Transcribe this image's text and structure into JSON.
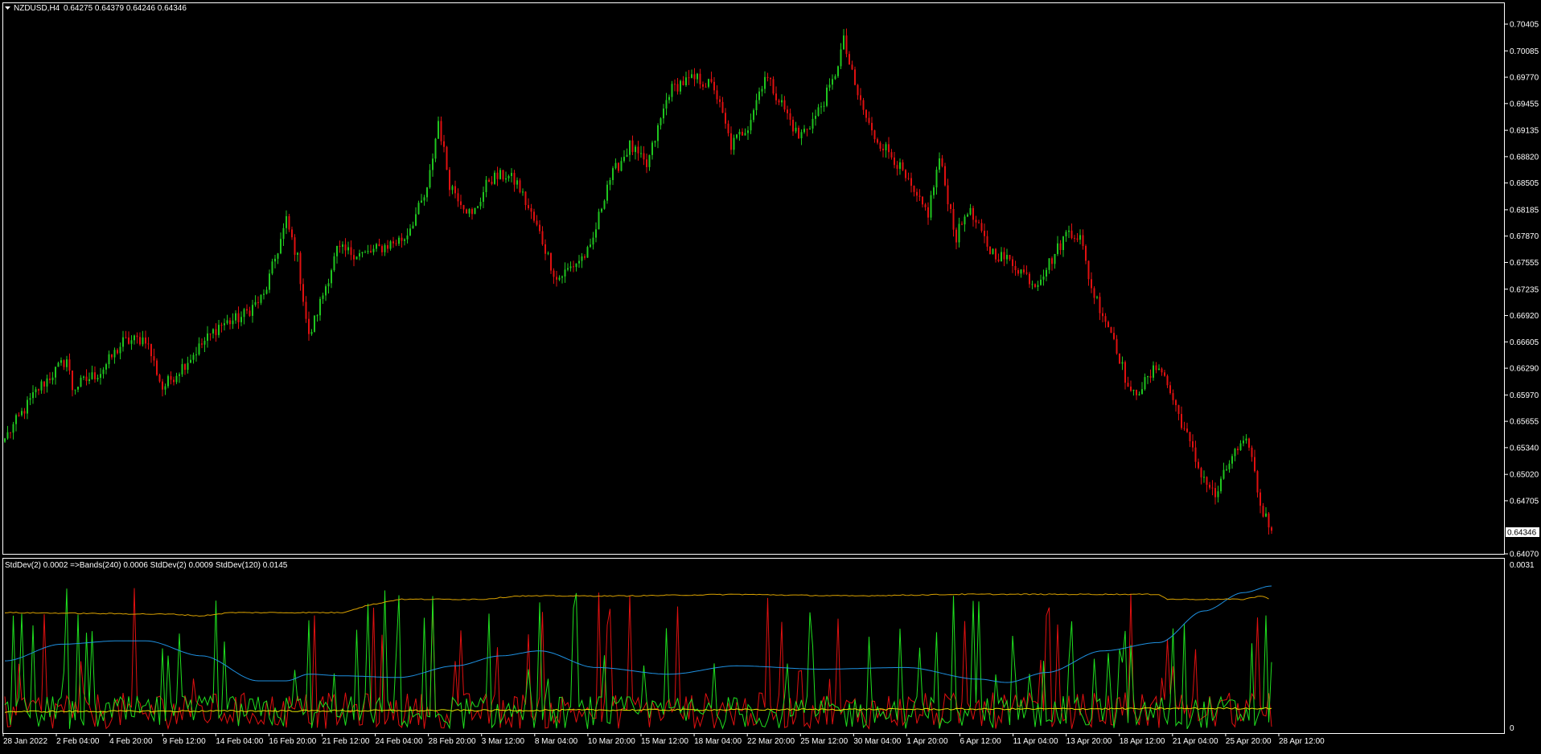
{
  "window": {
    "symbol_title": "NZDUSD,H4",
    "ohlc_text": "0.64275 0.64379 0.64246 0.64346",
    "current_price_label": "0.64346"
  },
  "indicator": {
    "label_text": "StdDev(2) 0.0002  =>Bands(240) 0.0006  StdDev(2) 0.0009  StdDev(120) 0.0145",
    "axis_top_label": "0.0031",
    "axis_bottom_label": "0"
  },
  "colors": {
    "background": "#000000",
    "axis": "#ffffff",
    "bull_candle": "#1fc51f",
    "bear_candle": "#e01010",
    "line_red": "#e01010",
    "line_green": "#1fe01f",
    "line_orange": "#d8a000",
    "line_blue": "#1e90e0",
    "line_yellow": "#e6e600"
  },
  "chart_data": [
    {
      "type": "candlestick",
      "title": "NZDUSD,H4",
      "ylim": [
        0.6407,
        0.70405
      ],
      "y_ticks": [
        "0.70405",
        "0.70085",
        "0.69770",
        "0.69455",
        "0.69135",
        "0.68820",
        "0.68505",
        "0.68185",
        "0.67870",
        "0.67555",
        "0.67235",
        "0.66920",
        "0.66605",
        "0.66290",
        "0.65970",
        "0.65655",
        "0.65340",
        "0.65020",
        "0.64705",
        "0.64070"
      ],
      "x_ticks": [
        "28 Jan 2022",
        "2 Feb 04:00",
        "4 Feb 20:00",
        "9 Feb 12:00",
        "14 Feb 04:00",
        "16 Feb 20:00",
        "21 Feb 12:00",
        "24 Feb 04:00",
        "28 Feb 20:00",
        "3 Mar 12:00",
        "8 Mar 04:00",
        "10 Mar 20:00",
        "15 Mar 12:00",
        "18 Mar 04:00",
        "22 Mar 20:00",
        "25 Mar 12:00",
        "30 Mar 04:00",
        "1 Apr 20:00",
        "6 Apr 12:00",
        "11 Apr 04:00",
        "13 Apr 20:00",
        "18 Apr 12:00",
        "21 Apr 04:00",
        "25 Apr 20:00",
        "28 Apr 12:00"
      ],
      "last_price": 0.64346,
      "price_path_keypoints": [
        [
          0,
          0.6545
        ],
        [
          12,
          0.6605
        ],
        [
          22,
          0.664
        ],
        [
          24,
          0.6605
        ],
        [
          34,
          0.6625
        ],
        [
          42,
          0.666
        ],
        [
          50,
          0.6665
        ],
        [
          56,
          0.6605
        ],
        [
          64,
          0.6635
        ],
        [
          76,
          0.668
        ],
        [
          84,
          0.669
        ],
        [
          92,
          0.6715
        ],
        [
          100,
          0.6805
        ],
        [
          104,
          0.676
        ],
        [
          108,
          0.6665
        ],
        [
          118,
          0.677
        ],
        [
          128,
          0.6765
        ],
        [
          142,
          0.6785
        ],
        [
          150,
          0.684
        ],
        [
          154,
          0.6925
        ],
        [
          158,
          0.685
        ],
        [
          166,
          0.681
        ],
        [
          172,
          0.6855
        ],
        [
          178,
          0.686
        ],
        [
          182,
          0.685
        ],
        [
          190,
          0.679
        ],
        [
          196,
          0.6735
        ],
        [
          208,
          0.677
        ],
        [
          214,
          0.685
        ],
        [
          222,
          0.6895
        ],
        [
          228,
          0.687
        ],
        [
          236,
          0.696
        ],
        [
          240,
          0.697
        ],
        [
          246,
          0.6975
        ],
        [
          252,
          0.6965
        ],
        [
          258,
          0.6895
        ],
        [
          264,
          0.692
        ],
        [
          270,
          0.698
        ],
        [
          276,
          0.6945
        ],
        [
          282,
          0.6905
        ],
        [
          288,
          0.693
        ],
        [
          294,
          0.697
        ],
        [
          298,
          0.702
        ],
        [
          302,
          0.6965
        ],
        [
          308,
          0.691
        ],
        [
          316,
          0.688
        ],
        [
          324,
          0.683
        ],
        [
          328,
          0.6815
        ],
        [
          332,
          0.688
        ],
        [
          338,
          0.6785
        ],
        [
          342,
          0.682
        ],
        [
          350,
          0.677
        ],
        [
          358,
          0.6755
        ],
        [
          366,
          0.673
        ],
        [
          372,
          0.676
        ],
        [
          378,
          0.6795
        ],
        [
          382,
          0.6785
        ],
        [
          386,
          0.6725
        ],
        [
          394,
          0.6665
        ],
        [
          400,
          0.6595
        ],
        [
          406,
          0.6615
        ],
        [
          410,
          0.6635
        ],
        [
          418,
          0.6565
        ],
        [
          424,
          0.651
        ],
        [
          430,
          0.6475
        ],
        [
          436,
          0.6525
        ],
        [
          442,
          0.654
        ],
        [
          446,
          0.6465
        ],
        [
          450,
          0.64346
        ]
      ],
      "price_min": 0.642,
      "price_max": 0.703
    },
    {
      "type": "line",
      "title": "StdDev(2) 0.0002  =>Bands(240) 0.0006  StdDev(2) 0.0009  StdDev(120) 0.0145",
      "ylim": [
        0,
        0.0031
      ],
      "series": [
        {
          "name": "StdDev(2)",
          "color": "#e01010",
          "last": 0.0002
        },
        {
          "name": "Bands(240)",
          "color": "#1fe01f",
          "last": 0.0006
        },
        {
          "name": "StdDev(2)",
          "color": "#e6e600",
          "last": 0.0009
        },
        {
          "name": "StdDev(120)",
          "color": "#1e90e0",
          "last": 0.0145
        },
        {
          "color": "#d8a000"
        }
      ]
    }
  ]
}
